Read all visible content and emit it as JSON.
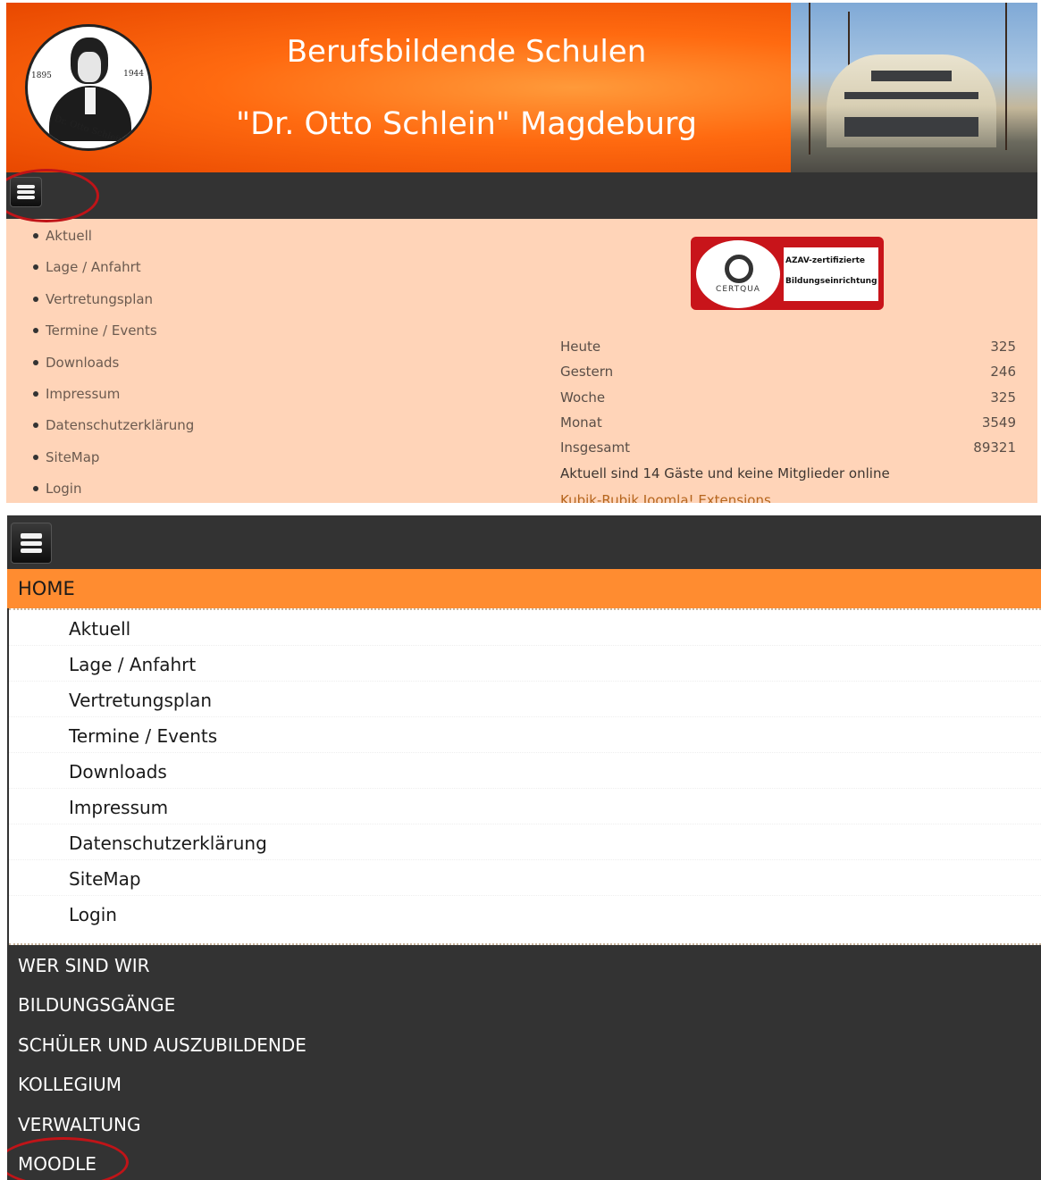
{
  "header": {
    "title_line1": "Berufsbildende Schulen",
    "title_line2": "\"Dr. Otto Schlein\" Magdeburg",
    "logo": {
      "year_left": "1895",
      "year_right": "1944",
      "signature": "Dr. Otto Schlein"
    }
  },
  "menu_toggle_icon": "hamburger-icon",
  "sidebar_menu": {
    "items": [
      "Aktuell",
      "Lage / Anfahrt",
      "Vertretungsplan",
      "Termine / Events",
      "Downloads",
      "Impressum",
      "Datenschutzerklärung",
      "SiteMap",
      "Login"
    ]
  },
  "badge": {
    "line1": "AZAV-zertifizierte",
    "line2": "Bildungseinrichtung",
    "seal_text": "CERTQUA"
  },
  "visitor_stats": {
    "rows": [
      {
        "label": "Heute",
        "value": "325"
      },
      {
        "label": "Gestern",
        "value": "246"
      },
      {
        "label": "Woche",
        "value": "325"
      },
      {
        "label": "Monat",
        "value": "3549"
      },
      {
        "label": "Insgesamt",
        "value": "89321"
      }
    ],
    "online_text": "Aktuell sind 14 Gäste und keine Mitglieder online",
    "credit_link": "Kubik-Rubik Joomla! Extensions"
  },
  "mobile_menu": {
    "home_label": "HOME",
    "sub_items": [
      "Aktuell",
      "Lage / Anfahrt",
      "Vertretungsplan",
      "Termine / Events",
      "Downloads",
      "Impressum",
      "Datenschutzerklärung",
      "SiteMap",
      "Login"
    ],
    "top_items": [
      "WER SIND WIR",
      "BILDUNGSGÄNGE",
      "SCHÜLER UND AUSZUBILDENDE",
      "KOLLEGIUM",
      "VERWALTUNG",
      "MOODLE"
    ]
  },
  "colors": {
    "banner_orange": "#ff6a10",
    "menu_bar": "#333333",
    "content_bg": "#ffd4b8",
    "home_active": "#ff8c30",
    "highlight_circle": "#c01418"
  }
}
